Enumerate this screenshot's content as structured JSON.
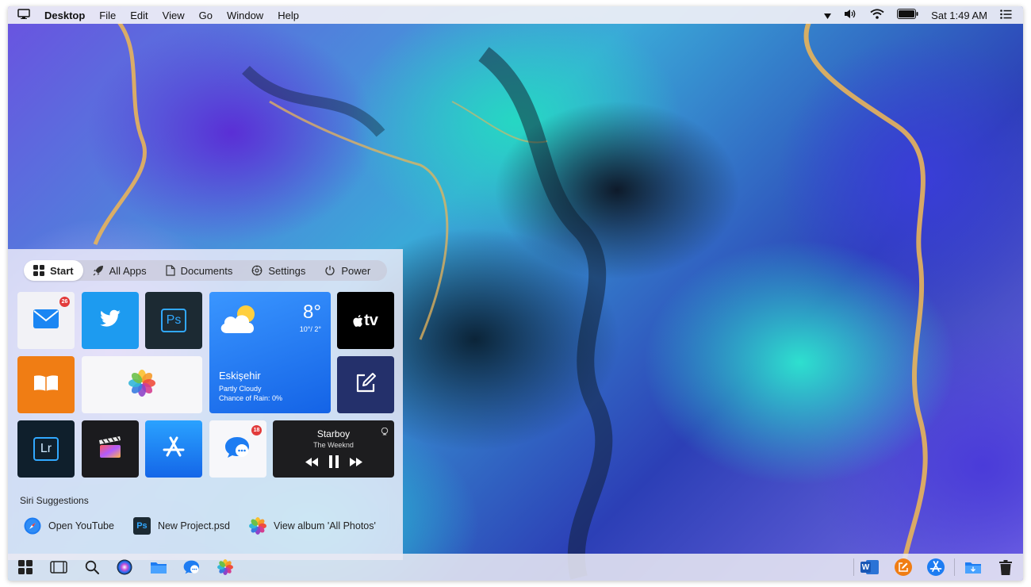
{
  "menubar": {
    "app_name": "Desktop",
    "menus": [
      "File",
      "Edit",
      "View",
      "Go",
      "Window",
      "Help"
    ],
    "clock": "Sat 1:49 AM"
  },
  "start_panel": {
    "tabs": [
      {
        "label": "Start",
        "icon": "windows-icon",
        "active": true
      },
      {
        "label": "All Apps",
        "icon": "rocket-icon",
        "active": false
      },
      {
        "label": "Documents",
        "icon": "document-icon",
        "active": false
      },
      {
        "label": "Settings",
        "icon": "gear-icon",
        "active": false
      },
      {
        "label": "Power",
        "icon": "power-icon",
        "active": false
      }
    ],
    "tiles": {
      "mail": {
        "badge": "26",
        "icon": "mail-icon"
      },
      "twitter": {
        "icon": "twitter-icon"
      },
      "photoshop": {
        "label": "Ps",
        "icon": "photoshop-icon"
      },
      "weather": {
        "temp": "8°",
        "range": "10°/ 2°",
        "city": "Eskişehir",
        "condition": "Partly Cloudy",
        "rain": "Chance of Rain: 0%"
      },
      "appletv": {
        "label": "tv",
        "icon": "apple-tv-icon"
      },
      "books": {
        "icon": "book-icon"
      },
      "photos": {
        "icon": "photos-icon"
      },
      "notes": {
        "icon": "compose-icon"
      },
      "lightroom": {
        "label": "Lr",
        "icon": "lightroom-icon"
      },
      "finalcut": {
        "icon": "clapper-icon"
      },
      "appstore": {
        "icon": "app-store-icon"
      },
      "messages": {
        "badge": "18",
        "icon": "messages-icon"
      },
      "music": {
        "song": "Starboy",
        "artist": "The Weeknd"
      }
    },
    "siri": {
      "title": "Siri Suggestions",
      "suggestions": [
        {
          "label": "Open YouTube",
          "icon": "safari-icon"
        },
        {
          "label": "New Project.psd",
          "icon": "photoshop-icon",
          "badge": "Ps"
        },
        {
          "label": "View album 'All Photos'",
          "icon": "photos-icon"
        }
      ]
    }
  },
  "colors": {
    "accent_blue": "#1d7cf2",
    "badge_red": "#e23b3b",
    "books_orange": "#f07d14"
  },
  "dock": {
    "word_label": "W"
  }
}
